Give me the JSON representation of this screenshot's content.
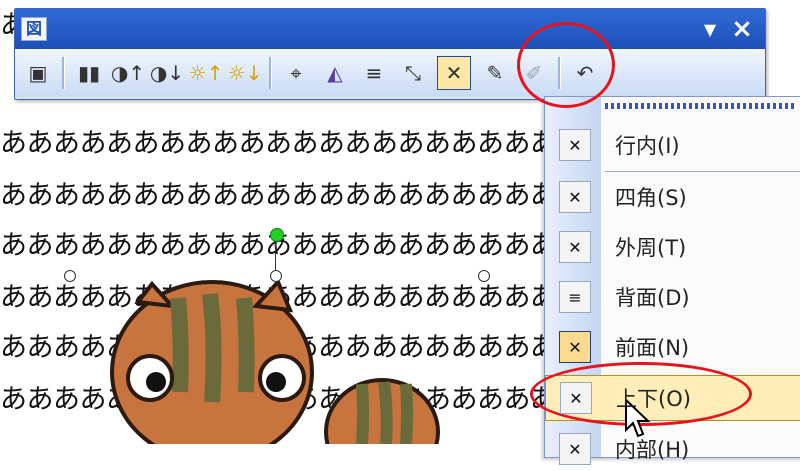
{
  "toolbar": {
    "title_icon": "図",
    "buttons": [
      {
        "name": "insert-picture-button",
        "icon": "picture-icon",
        "glyph": "▣"
      },
      {
        "name": "color-button",
        "icon": "color-icon",
        "glyph": "▮▮"
      },
      {
        "name": "more-contrast-button",
        "icon": "contrast-up-icon",
        "glyph": "◑↑"
      },
      {
        "name": "less-contrast-button",
        "icon": "contrast-down-icon",
        "glyph": "◑↓"
      },
      {
        "name": "more-brightness-button",
        "icon": "brightness-up-icon",
        "glyph": "☼↑"
      },
      {
        "name": "less-brightness-button",
        "icon": "brightness-down-icon",
        "glyph": "☼↓"
      },
      {
        "name": "crop-button",
        "icon": "crop-icon",
        "glyph": "⌖"
      },
      {
        "name": "rotate-left-button",
        "icon": "rotate-left-icon",
        "glyph": "◭"
      },
      {
        "name": "line-style-button",
        "icon": "line-style-icon",
        "glyph": "≡"
      },
      {
        "name": "compress-picture-button",
        "icon": "compress-icon",
        "glyph": "⤡"
      },
      {
        "name": "text-wrapping-button",
        "icon": "text-wrapping-icon",
        "glyph": "✕"
      },
      {
        "name": "format-picture-button",
        "icon": "format-picture-icon",
        "glyph": "✎"
      },
      {
        "name": "set-transparent-color-button",
        "icon": "transparent-color-icon",
        "glyph": "✐"
      },
      {
        "name": "reset-picture-button",
        "icon": "reset-picture-icon",
        "glyph": "↶"
      }
    ]
  },
  "document": {
    "line_text": "あああああああああああああああああああああああああああ"
  },
  "wrap_menu": {
    "items": [
      {
        "label": "行内(I)"
      },
      {
        "label": "四角(S)"
      },
      {
        "label": "外周(T)"
      },
      {
        "label": "背面(D)"
      },
      {
        "label": "前面(N)"
      },
      {
        "label": "上下(O)"
      },
      {
        "label": "内部(H)"
      }
    ]
  },
  "colors": {
    "titlebar": "#2f6ad7",
    "highlight": "#e8141c",
    "menu_hover": "#ffeeb9",
    "rotation_handle": "#21d024"
  }
}
